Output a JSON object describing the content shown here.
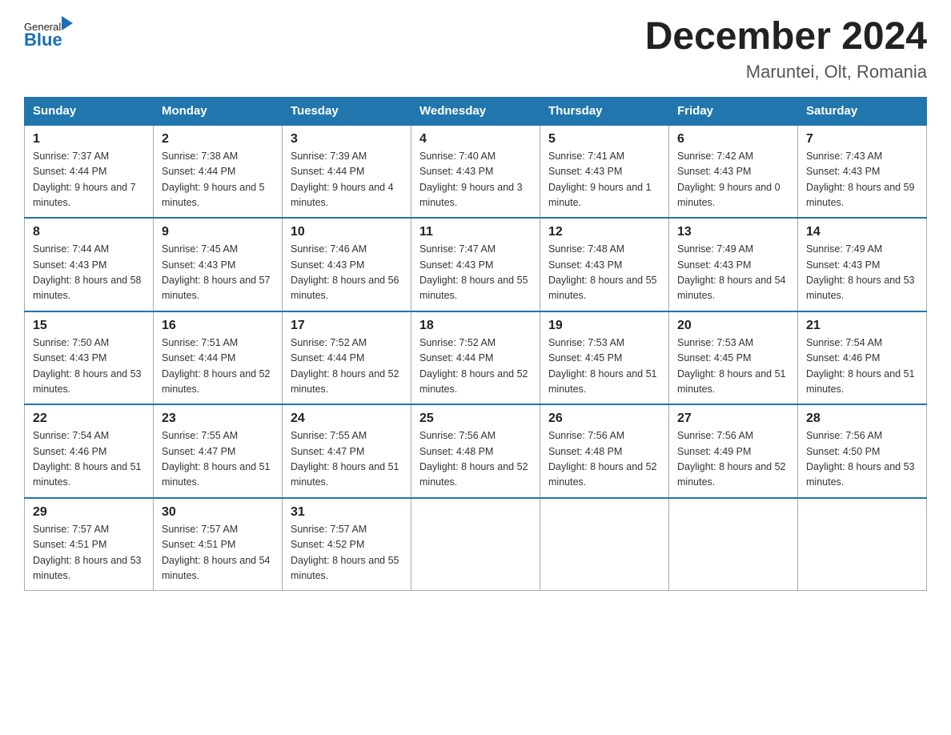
{
  "logo": {
    "general": "General",
    "blue": "Blue"
  },
  "title": "December 2024",
  "location": "Maruntei, Olt, Romania",
  "weekdays": [
    "Sunday",
    "Monday",
    "Tuesday",
    "Wednesday",
    "Thursday",
    "Friday",
    "Saturday"
  ],
  "weeks": [
    [
      {
        "day": "1",
        "sunrise": "7:37 AM",
        "sunset": "4:44 PM",
        "daylight": "9 hours and 7 minutes."
      },
      {
        "day": "2",
        "sunrise": "7:38 AM",
        "sunset": "4:44 PM",
        "daylight": "9 hours and 5 minutes."
      },
      {
        "day": "3",
        "sunrise": "7:39 AM",
        "sunset": "4:44 PM",
        "daylight": "9 hours and 4 minutes."
      },
      {
        "day": "4",
        "sunrise": "7:40 AM",
        "sunset": "4:43 PM",
        "daylight": "9 hours and 3 minutes."
      },
      {
        "day": "5",
        "sunrise": "7:41 AM",
        "sunset": "4:43 PM",
        "daylight": "9 hours and 1 minute."
      },
      {
        "day": "6",
        "sunrise": "7:42 AM",
        "sunset": "4:43 PM",
        "daylight": "9 hours and 0 minutes."
      },
      {
        "day": "7",
        "sunrise": "7:43 AM",
        "sunset": "4:43 PM",
        "daylight": "8 hours and 59 minutes."
      }
    ],
    [
      {
        "day": "8",
        "sunrise": "7:44 AM",
        "sunset": "4:43 PM",
        "daylight": "8 hours and 58 minutes."
      },
      {
        "day": "9",
        "sunrise": "7:45 AM",
        "sunset": "4:43 PM",
        "daylight": "8 hours and 57 minutes."
      },
      {
        "day": "10",
        "sunrise": "7:46 AM",
        "sunset": "4:43 PM",
        "daylight": "8 hours and 56 minutes."
      },
      {
        "day": "11",
        "sunrise": "7:47 AM",
        "sunset": "4:43 PM",
        "daylight": "8 hours and 55 minutes."
      },
      {
        "day": "12",
        "sunrise": "7:48 AM",
        "sunset": "4:43 PM",
        "daylight": "8 hours and 55 minutes."
      },
      {
        "day": "13",
        "sunrise": "7:49 AM",
        "sunset": "4:43 PM",
        "daylight": "8 hours and 54 minutes."
      },
      {
        "day": "14",
        "sunrise": "7:49 AM",
        "sunset": "4:43 PM",
        "daylight": "8 hours and 53 minutes."
      }
    ],
    [
      {
        "day": "15",
        "sunrise": "7:50 AM",
        "sunset": "4:43 PM",
        "daylight": "8 hours and 53 minutes."
      },
      {
        "day": "16",
        "sunrise": "7:51 AM",
        "sunset": "4:44 PM",
        "daylight": "8 hours and 52 minutes."
      },
      {
        "day": "17",
        "sunrise": "7:52 AM",
        "sunset": "4:44 PM",
        "daylight": "8 hours and 52 minutes."
      },
      {
        "day": "18",
        "sunrise": "7:52 AM",
        "sunset": "4:44 PM",
        "daylight": "8 hours and 52 minutes."
      },
      {
        "day": "19",
        "sunrise": "7:53 AM",
        "sunset": "4:45 PM",
        "daylight": "8 hours and 51 minutes."
      },
      {
        "day": "20",
        "sunrise": "7:53 AM",
        "sunset": "4:45 PM",
        "daylight": "8 hours and 51 minutes."
      },
      {
        "day": "21",
        "sunrise": "7:54 AM",
        "sunset": "4:46 PM",
        "daylight": "8 hours and 51 minutes."
      }
    ],
    [
      {
        "day": "22",
        "sunrise": "7:54 AM",
        "sunset": "4:46 PM",
        "daylight": "8 hours and 51 minutes."
      },
      {
        "day": "23",
        "sunrise": "7:55 AM",
        "sunset": "4:47 PM",
        "daylight": "8 hours and 51 minutes."
      },
      {
        "day": "24",
        "sunrise": "7:55 AM",
        "sunset": "4:47 PM",
        "daylight": "8 hours and 51 minutes."
      },
      {
        "day": "25",
        "sunrise": "7:56 AM",
        "sunset": "4:48 PM",
        "daylight": "8 hours and 52 minutes."
      },
      {
        "day": "26",
        "sunrise": "7:56 AM",
        "sunset": "4:48 PM",
        "daylight": "8 hours and 52 minutes."
      },
      {
        "day": "27",
        "sunrise": "7:56 AM",
        "sunset": "4:49 PM",
        "daylight": "8 hours and 52 minutes."
      },
      {
        "day": "28",
        "sunrise": "7:56 AM",
        "sunset": "4:50 PM",
        "daylight": "8 hours and 53 minutes."
      }
    ],
    [
      {
        "day": "29",
        "sunrise": "7:57 AM",
        "sunset": "4:51 PM",
        "daylight": "8 hours and 53 minutes."
      },
      {
        "day": "30",
        "sunrise": "7:57 AM",
        "sunset": "4:51 PM",
        "daylight": "8 hours and 54 minutes."
      },
      {
        "day": "31",
        "sunrise": "7:57 AM",
        "sunset": "4:52 PM",
        "daylight": "8 hours and 55 minutes."
      },
      null,
      null,
      null,
      null
    ]
  ],
  "labels": {
    "sunrise": "Sunrise:",
    "sunset": "Sunset:",
    "daylight": "Daylight:"
  }
}
